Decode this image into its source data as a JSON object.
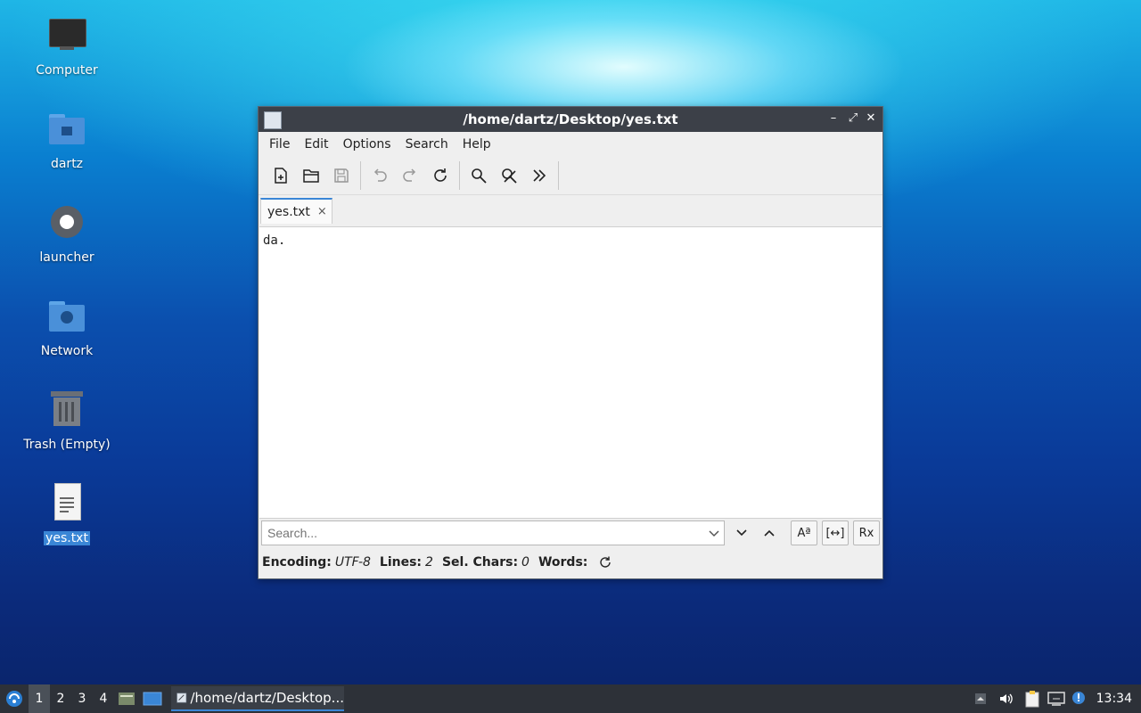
{
  "desktop": {
    "icons": [
      {
        "label": "Computer",
        "icon": "computer-icon"
      },
      {
        "label": "dartz",
        "icon": "home-folder-icon"
      },
      {
        "label": "launcher",
        "icon": "gear-icon"
      },
      {
        "label": "Network",
        "icon": "network-folder-icon"
      },
      {
        "label": "Trash (Empty)",
        "icon": "trash-icon"
      },
      {
        "label": "yes.txt",
        "icon": "text-file-icon"
      }
    ]
  },
  "window": {
    "title": "/home/dartz/Desktop/yes.txt",
    "controls": {
      "minimize": "–",
      "maximize": "⤢",
      "close": "✕"
    },
    "menu": [
      "File",
      "Edit",
      "Options",
      "Search",
      "Help"
    ],
    "toolbar": [
      "new-file-icon",
      "open-folder-icon",
      "save-icon",
      "undo-icon",
      "redo-icon",
      "reload-icon",
      "find-icon",
      "replace-icon",
      "more-icon"
    ],
    "tab": {
      "label": "yes.txt",
      "close": "×"
    },
    "editor_text": "da.",
    "search": {
      "placeholder": "Search..."
    },
    "search_buttons": {
      "match_case": "Aª",
      "whole_word": "[↔]",
      "regex": "Rx"
    },
    "status": {
      "encoding_label": "Encoding:",
      "encoding_value": "UTF-8",
      "lines_label": "Lines:",
      "lines_value": "2",
      "sel_label": "Sel. Chars:",
      "sel_value": "0",
      "words_label": "Words:"
    }
  },
  "taskbar": {
    "workspaces": [
      "1",
      "2",
      "3",
      "4"
    ],
    "active_workspace": "1",
    "task_title": "/home/dartz/Desktop...",
    "clock": "13:34"
  },
  "colors": {
    "accent": "#3a86d6",
    "titlebar": "#3c4048",
    "taskbar": "#2d3138"
  }
}
